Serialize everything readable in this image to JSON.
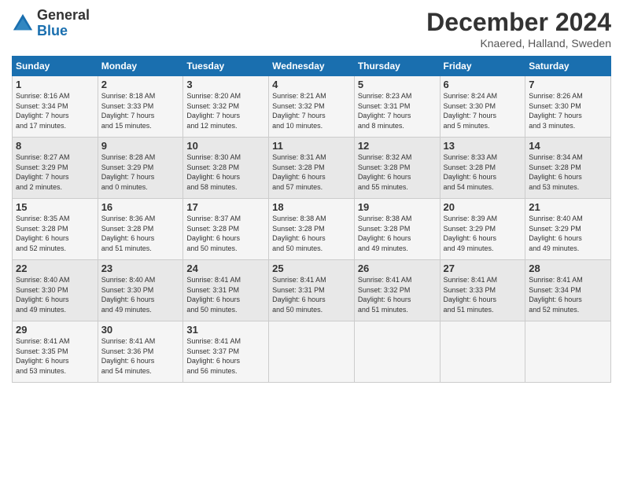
{
  "header": {
    "logo_general": "General",
    "logo_blue": "Blue",
    "title": "December 2024",
    "location": "Knaered, Halland, Sweden"
  },
  "days_of_week": [
    "Sunday",
    "Monday",
    "Tuesday",
    "Wednesday",
    "Thursday",
    "Friday",
    "Saturday"
  ],
  "weeks": [
    [
      {
        "day": "1",
        "info": "Sunrise: 8:16 AM\nSunset: 3:34 PM\nDaylight: 7 hours\nand 17 minutes."
      },
      {
        "day": "2",
        "info": "Sunrise: 8:18 AM\nSunset: 3:33 PM\nDaylight: 7 hours\nand 15 minutes."
      },
      {
        "day": "3",
        "info": "Sunrise: 8:20 AM\nSunset: 3:32 PM\nDaylight: 7 hours\nand 12 minutes."
      },
      {
        "day": "4",
        "info": "Sunrise: 8:21 AM\nSunset: 3:32 PM\nDaylight: 7 hours\nand 10 minutes."
      },
      {
        "day": "5",
        "info": "Sunrise: 8:23 AM\nSunset: 3:31 PM\nDaylight: 7 hours\nand 8 minutes."
      },
      {
        "day": "6",
        "info": "Sunrise: 8:24 AM\nSunset: 3:30 PM\nDaylight: 7 hours\nand 5 minutes."
      },
      {
        "day": "7",
        "info": "Sunrise: 8:26 AM\nSunset: 3:30 PM\nDaylight: 7 hours\nand 3 minutes."
      }
    ],
    [
      {
        "day": "8",
        "info": "Sunrise: 8:27 AM\nSunset: 3:29 PM\nDaylight: 7 hours\nand 2 minutes."
      },
      {
        "day": "9",
        "info": "Sunrise: 8:28 AM\nSunset: 3:29 PM\nDaylight: 7 hours\nand 0 minutes."
      },
      {
        "day": "10",
        "info": "Sunrise: 8:30 AM\nSunset: 3:28 PM\nDaylight: 6 hours\nand 58 minutes."
      },
      {
        "day": "11",
        "info": "Sunrise: 8:31 AM\nSunset: 3:28 PM\nDaylight: 6 hours\nand 57 minutes."
      },
      {
        "day": "12",
        "info": "Sunrise: 8:32 AM\nSunset: 3:28 PM\nDaylight: 6 hours\nand 55 minutes."
      },
      {
        "day": "13",
        "info": "Sunrise: 8:33 AM\nSunset: 3:28 PM\nDaylight: 6 hours\nand 54 minutes."
      },
      {
        "day": "14",
        "info": "Sunrise: 8:34 AM\nSunset: 3:28 PM\nDaylight: 6 hours\nand 53 minutes."
      }
    ],
    [
      {
        "day": "15",
        "info": "Sunrise: 8:35 AM\nSunset: 3:28 PM\nDaylight: 6 hours\nand 52 minutes."
      },
      {
        "day": "16",
        "info": "Sunrise: 8:36 AM\nSunset: 3:28 PM\nDaylight: 6 hours\nand 51 minutes."
      },
      {
        "day": "17",
        "info": "Sunrise: 8:37 AM\nSunset: 3:28 PM\nDaylight: 6 hours\nand 50 minutes."
      },
      {
        "day": "18",
        "info": "Sunrise: 8:38 AM\nSunset: 3:28 PM\nDaylight: 6 hours\nand 50 minutes."
      },
      {
        "day": "19",
        "info": "Sunrise: 8:38 AM\nSunset: 3:28 PM\nDaylight: 6 hours\nand 49 minutes."
      },
      {
        "day": "20",
        "info": "Sunrise: 8:39 AM\nSunset: 3:29 PM\nDaylight: 6 hours\nand 49 minutes."
      },
      {
        "day": "21",
        "info": "Sunrise: 8:40 AM\nSunset: 3:29 PM\nDaylight: 6 hours\nand 49 minutes."
      }
    ],
    [
      {
        "day": "22",
        "info": "Sunrise: 8:40 AM\nSunset: 3:30 PM\nDaylight: 6 hours\nand 49 minutes."
      },
      {
        "day": "23",
        "info": "Sunrise: 8:40 AM\nSunset: 3:30 PM\nDaylight: 6 hours\nand 49 minutes."
      },
      {
        "day": "24",
        "info": "Sunrise: 8:41 AM\nSunset: 3:31 PM\nDaylight: 6 hours\nand 50 minutes."
      },
      {
        "day": "25",
        "info": "Sunrise: 8:41 AM\nSunset: 3:31 PM\nDaylight: 6 hours\nand 50 minutes."
      },
      {
        "day": "26",
        "info": "Sunrise: 8:41 AM\nSunset: 3:32 PM\nDaylight: 6 hours\nand 51 minutes."
      },
      {
        "day": "27",
        "info": "Sunrise: 8:41 AM\nSunset: 3:33 PM\nDaylight: 6 hours\nand 51 minutes."
      },
      {
        "day": "28",
        "info": "Sunrise: 8:41 AM\nSunset: 3:34 PM\nDaylight: 6 hours\nand 52 minutes."
      }
    ],
    [
      {
        "day": "29",
        "info": "Sunrise: 8:41 AM\nSunset: 3:35 PM\nDaylight: 6 hours\nand 53 minutes."
      },
      {
        "day": "30",
        "info": "Sunrise: 8:41 AM\nSunset: 3:36 PM\nDaylight: 6 hours\nand 54 minutes."
      },
      {
        "day": "31",
        "info": "Sunrise: 8:41 AM\nSunset: 3:37 PM\nDaylight: 6 hours\nand 56 minutes."
      },
      {
        "day": "",
        "info": ""
      },
      {
        "day": "",
        "info": ""
      },
      {
        "day": "",
        "info": ""
      },
      {
        "day": "",
        "info": ""
      }
    ]
  ]
}
